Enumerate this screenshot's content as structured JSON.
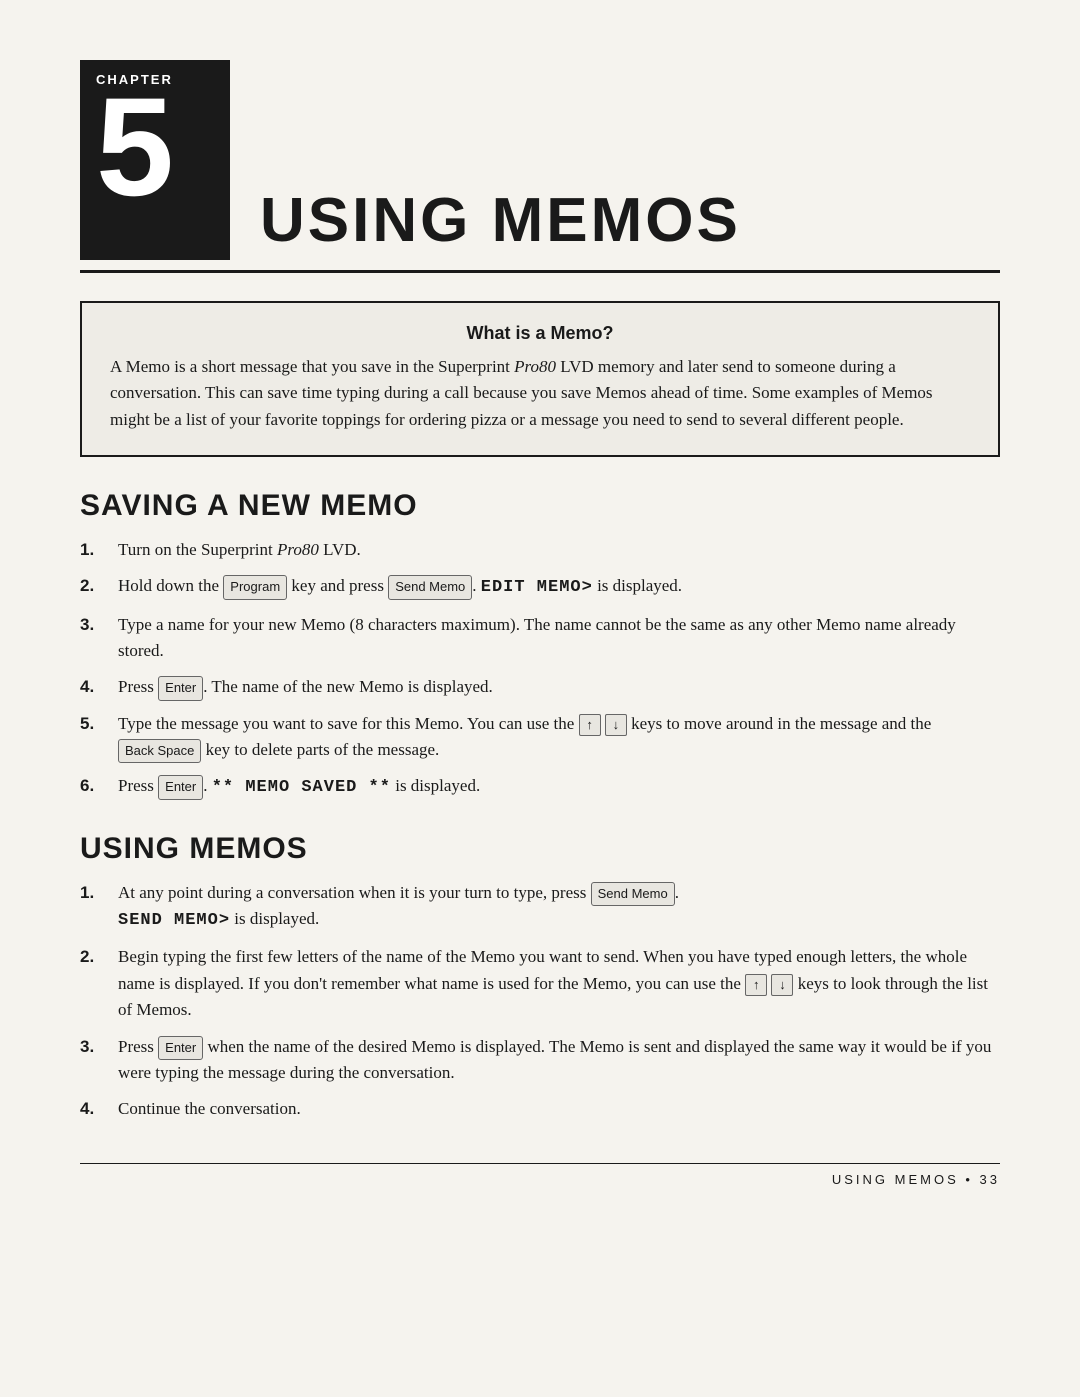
{
  "chapter": {
    "label": "CHAPTER",
    "number": "5",
    "title": "USING MEMOS"
  },
  "infoBox": {
    "title": "What is a Memo?",
    "text": "A Memo is a short message that you save in the Superprint Pro80 LVD memory and later send to someone during a conversation. This can save time typing during a call because you save Memos ahead of time. Some examples of Memos might be a list of your favorite toppings for ordering pizza or a message you need to send to several different people."
  },
  "section1": {
    "title": "SAVING A NEW MEMO",
    "steps": [
      {
        "num": "1.",
        "text": "Turn on the Superprint Pro80 LVD."
      },
      {
        "num": "2.",
        "parts": [
          "Hold down the ",
          "Program",
          " key and press ",
          "Send Memo",
          ". ",
          "EDIT MEMO>",
          " is displayed."
        ]
      },
      {
        "num": "3.",
        "text": "Type a name for your new Memo (8 characters maximum). The name cannot be the same as any other Memo name already stored."
      },
      {
        "num": "4.",
        "parts": [
          "Press ",
          "Enter",
          ". The name of the new Memo is displayed."
        ]
      },
      {
        "num": "5.",
        "parts_complex": true,
        "text": "Type the message you want to save for this Memo. You can use the up/down arrow keys to move around in the message and the Back Space key to delete parts of the message."
      },
      {
        "num": "6.",
        "parts": [
          "Press ",
          "Enter",
          ". ** ",
          "MEMO SAVED **",
          " is displayed."
        ]
      }
    ]
  },
  "section2": {
    "title": "USING MEMOS",
    "steps": [
      {
        "num": "1.",
        "parts": [
          "At any point during a conversation when it is your turn to type, press ",
          "Send Memo",
          ". ",
          "SEND MEMO>",
          " is displayed."
        ]
      },
      {
        "num": "2.",
        "text": "Begin typing the first few letters of the name of the Memo you want to send. When you have typed enough letters, the whole name is displayed. If you don't remember what name is used for the Memo, you can use the up/down arrow keys to look through the list of Memos."
      },
      {
        "num": "3.",
        "parts": [
          "Press ",
          "Enter",
          " when the name of the desired Memo is displayed. The Memo is sent and displayed the same way it would be if you were typing the message during the conversation."
        ]
      },
      {
        "num": "4.",
        "text": "Continue the conversation."
      }
    ]
  },
  "footer": {
    "text": "USING MEMOS  •  33"
  }
}
